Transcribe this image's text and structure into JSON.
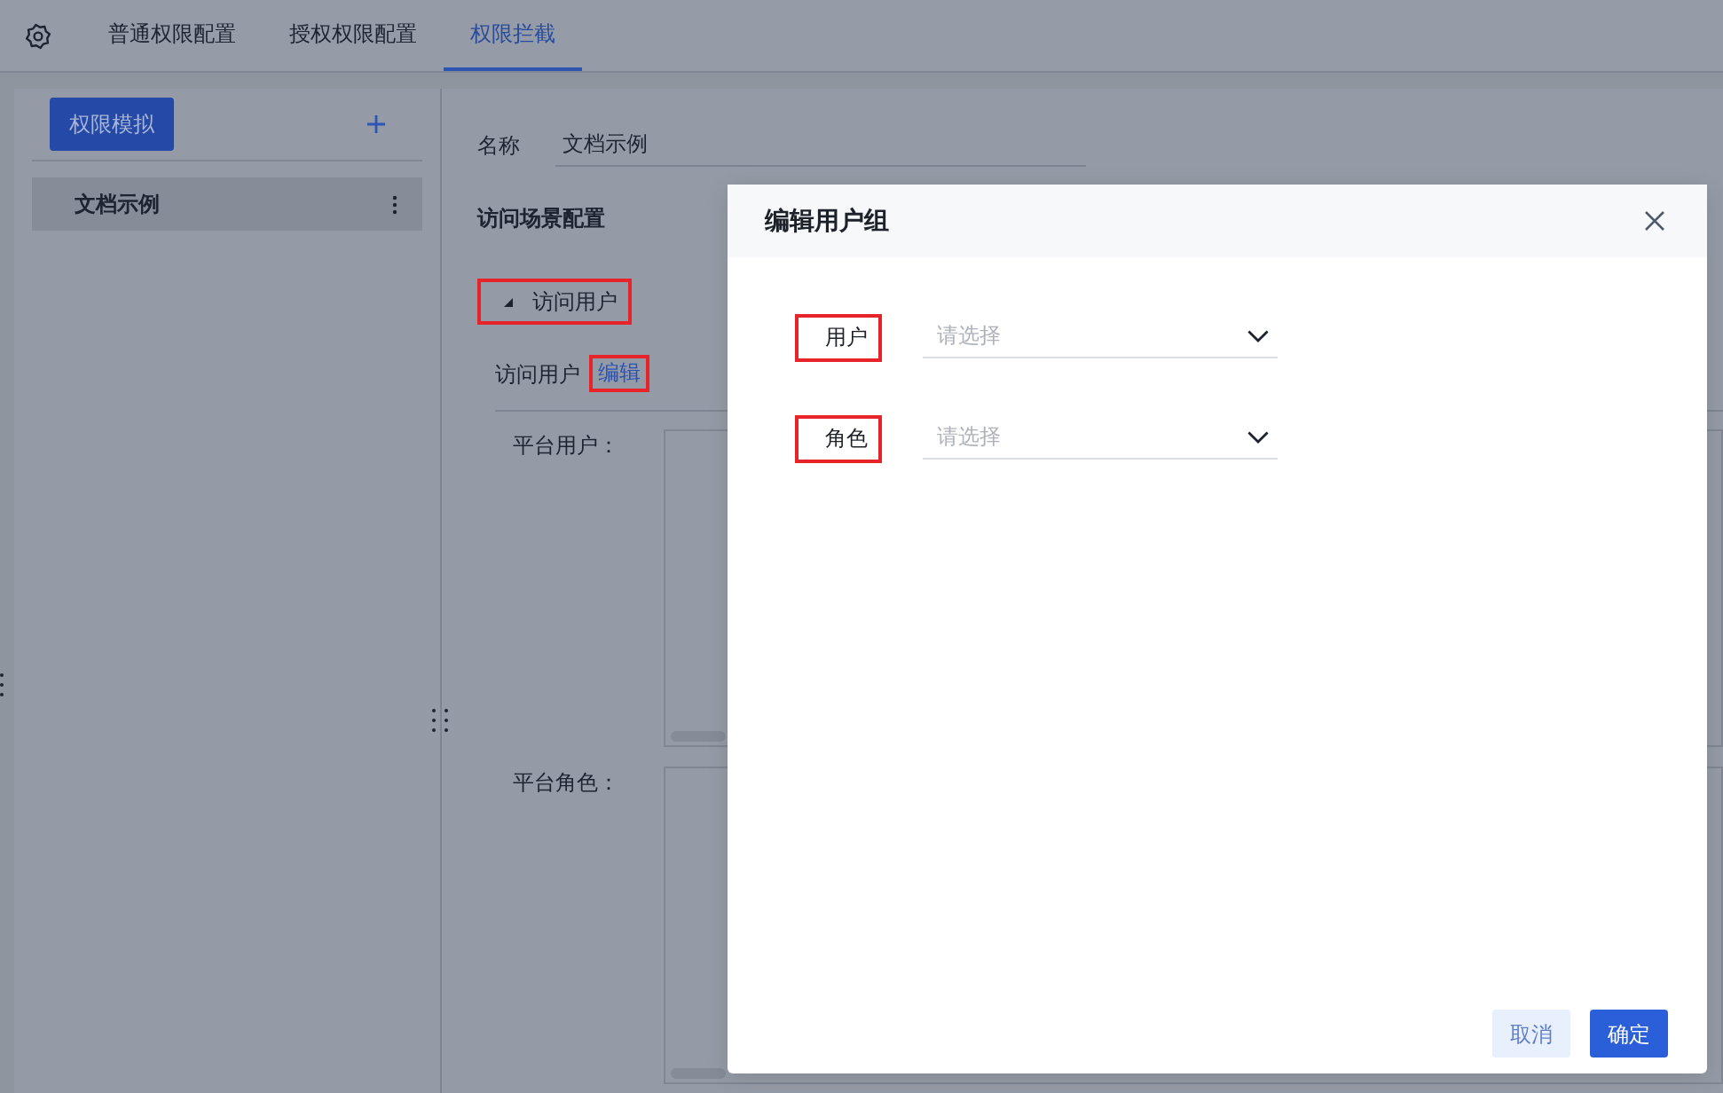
{
  "top_bar": {
    "tabs": [
      {
        "label": "普通权限配置",
        "selected": false
      },
      {
        "label": "授权权限配置",
        "selected": false
      },
      {
        "label": "权限拦截",
        "selected": true
      }
    ]
  },
  "sidebar": {
    "button": "权限模拟",
    "items": [
      {
        "label": "文档示例",
        "selected": true
      }
    ]
  },
  "form": {
    "name_label": "名称",
    "name_value": "文档示例",
    "section_title": "访问场景配置",
    "group": {
      "label": "访问用户",
      "expanded": true,
      "highlighted": true
    },
    "edit_row": {
      "label": "访问用户",
      "link": "编辑",
      "highlighted": true
    },
    "lists": [
      {
        "label": "平台用户："
      },
      {
        "label": "平台角色："
      }
    ]
  },
  "dialog": {
    "title": "编辑用户组",
    "fields": [
      {
        "label": "用户",
        "placeholder": "请选择",
        "highlighted": true
      },
      {
        "label": "角色",
        "placeholder": "请选择",
        "highlighted": true
      }
    ],
    "buttons": [
      {
        "label": "取消",
        "kind": "secondary"
      },
      {
        "label": "确定",
        "kind": "primary"
      }
    ]
  }
}
